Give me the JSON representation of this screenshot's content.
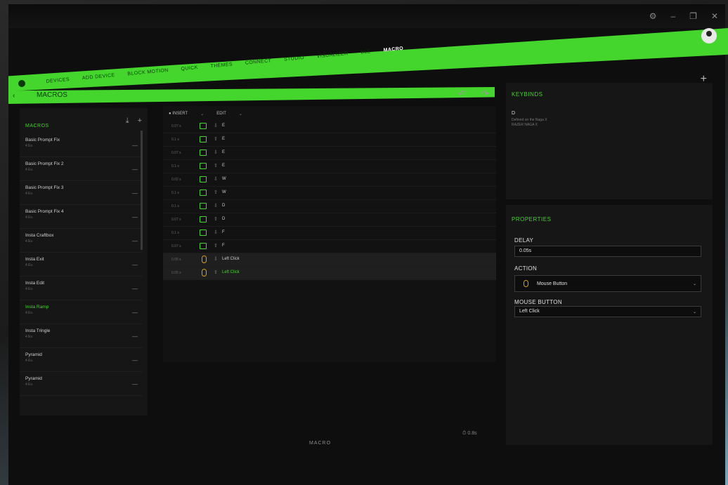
{
  "window": {
    "controls": [
      "⚙",
      "–",
      "❐",
      "✕"
    ]
  },
  "nav": {
    "tabs": [
      "DEVICES",
      "ADD DEVICE",
      "BLOCK MOTION",
      "QUICK",
      "THEMES",
      "CONNECT",
      "STUDIO",
      "VISUALIZER",
      "BLE",
      "MACRO"
    ],
    "active_index": 9
  },
  "subbar": {
    "back": "‹",
    "title": "MACROS"
  },
  "macros_panel": {
    "header": "MACROS",
    "icons": [
      "⤓",
      "+"
    ],
    "items": [
      {
        "name": "Basic Prompt Fix",
        "sub": "4 Ev."
      },
      {
        "name": "Basic Prompt Fix 2",
        "sub": "4 Ev."
      },
      {
        "name": "Basic Prompt Fix 3",
        "sub": "4 Ev."
      },
      {
        "name": "Basic Prompt Fix 4",
        "sub": "4 Ev."
      },
      {
        "name": "Insta Craftbox",
        "sub": "4 Ev."
      },
      {
        "name": "Insta Exit",
        "sub": "4 Ev."
      },
      {
        "name": "Insta Edit",
        "sub": "4 Ev."
      },
      {
        "name": "Insta Ramp",
        "sub": "4 Ev."
      },
      {
        "name": "Insta Tringle",
        "sub": "4 Ev."
      },
      {
        "name": "Pyramid",
        "sub": "4 Ev."
      },
      {
        "name": "Pyramid",
        "sub": "4 Ev."
      }
    ],
    "selected_index": 7,
    "dots": "—"
  },
  "editor": {
    "toolbar": [
      "● INSERT",
      "⌄",
      "EDIT",
      "⌄"
    ],
    "undo_icons": [
      "↶",
      "↷"
    ],
    "rows": [
      {
        "delay": "0.07 s",
        "type": "key",
        "dir": "⇩",
        "label": "E"
      },
      {
        "delay": "0.1 s",
        "type": "key",
        "dir": "⇧",
        "label": "E"
      },
      {
        "delay": "0.07 s",
        "type": "key",
        "dir": "⇩",
        "label": "E"
      },
      {
        "delay": "0.1 s",
        "type": "key",
        "dir": "⇧",
        "label": "E"
      },
      {
        "delay": "0.02 s",
        "type": "key",
        "dir": "⇩",
        "label": "W"
      },
      {
        "delay": "0.1 s",
        "type": "key",
        "dir": "⇧",
        "label": "W"
      },
      {
        "delay": "0.1 s",
        "type": "key",
        "dir": "⇩",
        "label": "D"
      },
      {
        "delay": "0.07 s",
        "type": "key",
        "dir": "⇧",
        "label": "D"
      },
      {
        "delay": "0.1 s",
        "type": "key",
        "dir": "⇩",
        "label": "F"
      },
      {
        "delay": "0.07 s",
        "type": "key",
        "dir": "⇧",
        "label": "F"
      },
      {
        "delay": "0.05 s",
        "type": "mouse",
        "dir": "⇩",
        "label": "Left Click"
      },
      {
        "delay": "0.05 s",
        "type": "mouse",
        "dir": "⇧",
        "label": "Left Click"
      }
    ],
    "highlight_indices": [
      10,
      11
    ],
    "green_label_indices": [
      11
    ],
    "clock": "⏱ 0.8s",
    "footer_label": "MACRO"
  },
  "keybinds": {
    "header": "KEYBINDS",
    "add": "+",
    "key": "D",
    "desc_line1": "Defined on the Naga X",
    "desc_line2": "RAZER NAGA X"
  },
  "properties": {
    "header": "PROPERTIES",
    "delay_label": "DELAY",
    "delay_value": "0.05s",
    "action_label": "ACTION",
    "action_value": "Mouse Button",
    "mouse_button_label": "MOUSE BUTTON",
    "mouse_button_value": "Left Click",
    "caret": "⌄"
  },
  "colors": {
    "accent": "#44d62c",
    "mouse": "#d4a017",
    "bg": "#0e0e0e"
  }
}
